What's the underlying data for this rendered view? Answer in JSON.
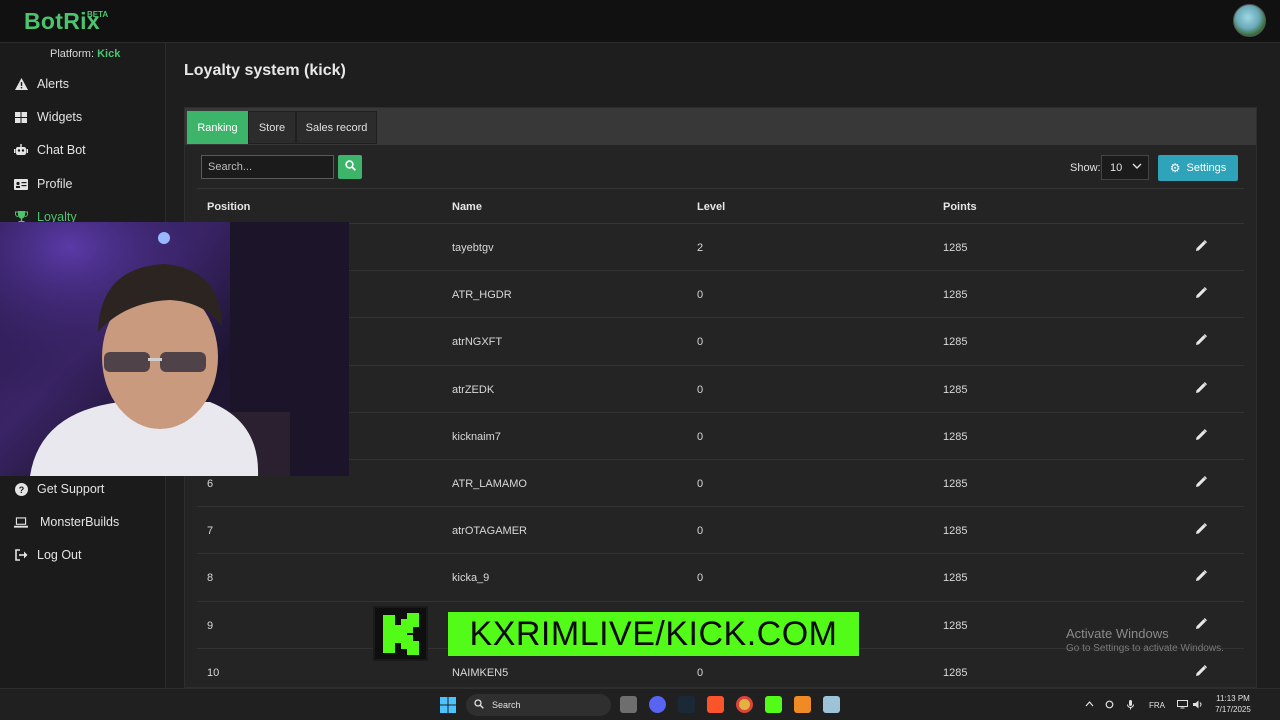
{
  "app": {
    "logo": "BotRix",
    "logo_badge": "BETA"
  },
  "sidebar": {
    "platform_label": "Platform:",
    "platform_value": "Kick",
    "items": [
      {
        "label": "Alerts",
        "icon": "warning-icon"
      },
      {
        "label": "Widgets",
        "icon": "grid-icon"
      },
      {
        "label": "Chat Bot",
        "icon": "robot-icon"
      },
      {
        "label": "Profile",
        "icon": "id-card-icon"
      },
      {
        "label": "Loyalty",
        "icon": "trophy-icon"
      },
      {
        "label": "Get Support",
        "icon": "question-circle-icon"
      },
      {
        "label": "MonsterBuilds",
        "icon": "laptop-icon"
      },
      {
        "label": "Log Out",
        "icon": "sign-out-icon"
      }
    ]
  },
  "main": {
    "title": "Loyalty system (kick)",
    "tabs": [
      "Ranking",
      "Store",
      "Sales record"
    ],
    "search_placeholder": "Search...",
    "show_label": "Show:",
    "show_value": "10",
    "settings_label": "Settings",
    "columns": [
      "Position",
      "Name",
      "Level",
      "Points"
    ],
    "rows": [
      {
        "position": "",
        "name": "tayebtgv",
        "level": "2",
        "points": "1285"
      },
      {
        "position": "",
        "name": "ATR_HGDR",
        "level": "0",
        "points": "1285"
      },
      {
        "position": "",
        "name": "atrNGXFT",
        "level": "0",
        "points": "1285"
      },
      {
        "position": "",
        "name": "atrZEDK",
        "level": "0",
        "points": "1285"
      },
      {
        "position": "",
        "name": "kicknaim7",
        "level": "0",
        "points": "1285"
      },
      {
        "position": "6",
        "name": "ATR_LAMAMO",
        "level": "0",
        "points": "1285"
      },
      {
        "position": "7",
        "name": "atrOTAGAMER",
        "level": "0",
        "points": "1285"
      },
      {
        "position": "8",
        "name": "kicka_9",
        "level": "0",
        "points": "1285"
      },
      {
        "position": "9",
        "name": "",
        "level": "",
        "points": "1285"
      },
      {
        "position": "10",
        "name": "NAIMKEN5",
        "level": "0",
        "points": "1285"
      }
    ]
  },
  "overlay": {
    "banner_text": "KXRIMLIVE/KICK.COM"
  },
  "windows_watermark": {
    "line1": "Activate Windows",
    "line2": "Go to Settings to activate Windows."
  },
  "taskbar": {
    "search": "Search",
    "lang": "FRA",
    "time": "11:13 PM",
    "date": "7/17/2025"
  },
  "colors": {
    "accent_green": "#3cb46a",
    "kick_green": "#53fc18",
    "settings_teal": "#2fa3b9"
  }
}
